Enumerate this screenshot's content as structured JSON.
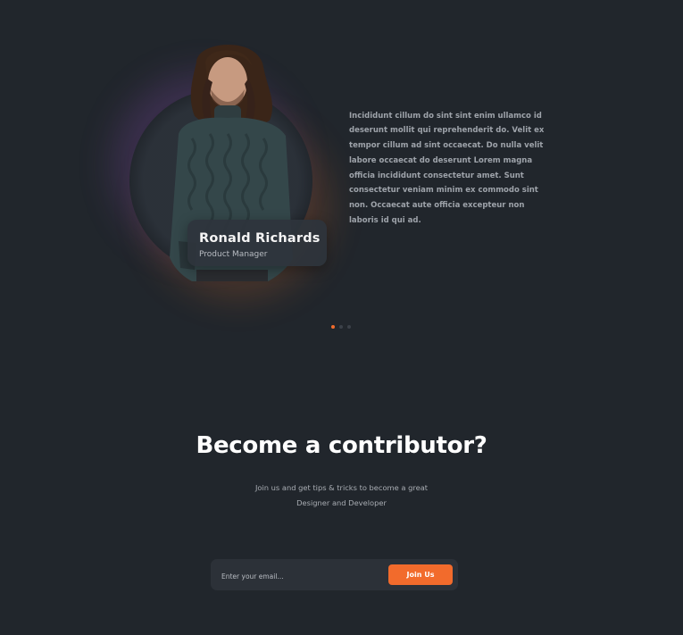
{
  "testimonial": {
    "name": "Ronald Richards",
    "role": "Product Manager",
    "quote": "Incididunt cillum do sint sint enim ullamco id deserunt mollit qui reprehenderit do. Velit ex tempor cillum ad sint occaecat. Do nulla velit labore occaecat do deserunt Lorem magna officia incididunt consectetur amet. Sunt consectetur veniam minim ex commodo sint non. Occaecat aute officia excepteur non laboris id qui ad.",
    "slides": [
      {
        "active": true
      },
      {
        "active": false
      },
      {
        "active": false
      }
    ]
  },
  "contributor": {
    "title": "Become a contributor?",
    "subtitle_line1": "Join us and get tips & tricks to become a great",
    "subtitle_line2": "Designer and Developer",
    "email_placeholder": "Enter your email...",
    "join_label": "Join Us"
  },
  "colors": {
    "background": "#21262c",
    "accent": "#f26b2c",
    "card": "#2c3138"
  },
  "icons": {
    "portrait": "person-photo"
  }
}
